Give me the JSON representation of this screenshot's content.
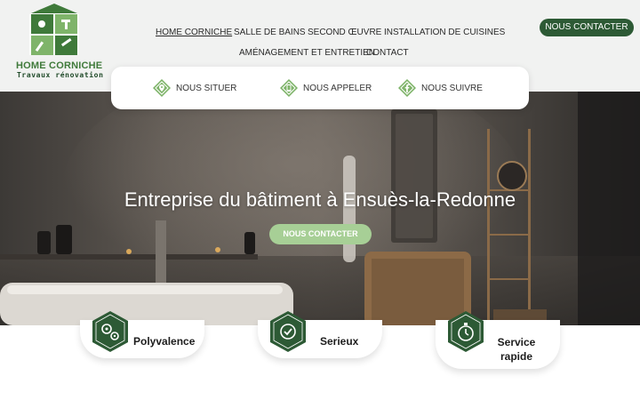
{
  "brand": {
    "name": "HOME CORNICHE",
    "tagline": "Travaux rénovation",
    "color_primary": "#2d5a35",
    "color_accent": "#a7cf96",
    "color_brand_text": "#3f7a3a"
  },
  "nav": {
    "items": [
      {
        "label": "HOME CORNICHE",
        "active": true
      },
      {
        "label": "SALLE DE BAINS",
        "active": false
      },
      {
        "label": "SECOND ŒUVRE",
        "active": false
      },
      {
        "label": "INSTALLATION DE CUISINES",
        "active": false
      },
      {
        "label": "AMÉNAGEMENT ET ENTRETIEN",
        "active": false
      },
      {
        "label": "CONTACT",
        "active": false
      }
    ],
    "cta_label": "NOUS CONTACTER"
  },
  "info_bar": {
    "items": [
      {
        "label": "NOUS SITUER",
        "icon": "map-pin-icon"
      },
      {
        "label": "NOUS APPELER",
        "icon": "phone-icon"
      },
      {
        "label": "NOUS SUIVRE",
        "icon": "facebook-icon"
      }
    ]
  },
  "hero": {
    "title": "Entreprise du bâtiment à Ensuès-la-Redonne",
    "cta_label": "NOUS CONTACTER"
  },
  "features": [
    {
      "label": "Polyvalence",
      "icon": "gears-icon"
    },
    {
      "label": "Serieux",
      "icon": "badge-check-icon"
    },
    {
      "label": "Service rapide",
      "icon": "stopwatch-icon"
    }
  ]
}
